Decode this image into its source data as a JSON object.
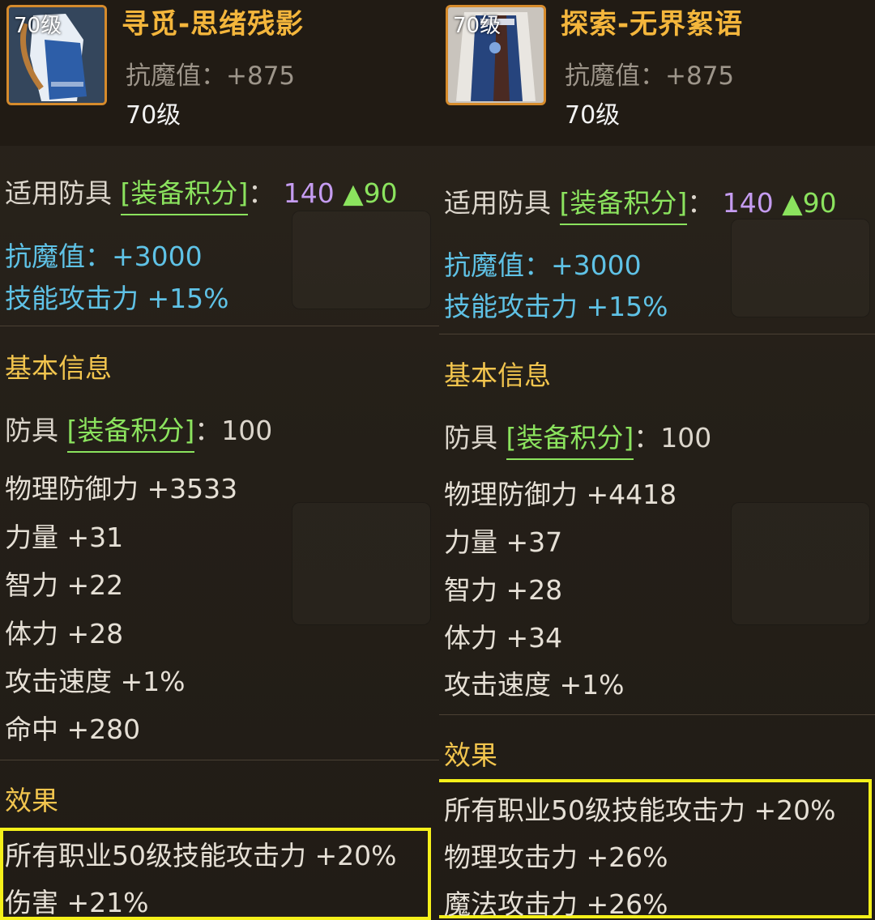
{
  "items": [
    {
      "thumb_level": "70级",
      "name": "寻觅-思绪残影",
      "magic_resist_label": "抗魔值：",
      "magic_resist_value": "+875",
      "level": "70级",
      "applicable_prefix": "适用防具",
      "applicable_tag": "[装备积分]",
      "applicable_colon": "：",
      "applicable_score": "140",
      "applicable_up": "▲90",
      "bonus_mres": "抗魔值：+3000",
      "bonus_skill": "技能攻击力 +15%",
      "basic_title": "基本信息",
      "armor_prefix": "防具",
      "armor_tag": "[装备积分]",
      "armor_value": "：100",
      "stats": [
        "物理防御力 +3533",
        "力量 +31",
        "智力 +22",
        "体力 +28",
        "攻击速度 +1%",
        "命中 +280"
      ],
      "effects_title": "效果",
      "effects": [
        "所有职业50级技能攻击力 +20%",
        "伤害 +21%"
      ]
    },
    {
      "thumb_level": "70级",
      "name": "探索-无界絮语",
      "magic_resist_label": "抗魔值：",
      "magic_resist_value": "+875",
      "level": "70级",
      "applicable_prefix": "适用防具",
      "applicable_tag": "[装备积分]",
      "applicable_colon": "：",
      "applicable_score": "140",
      "applicable_up": "▲90",
      "bonus_mres": "抗魔值：+3000",
      "bonus_skill": "技能攻击力 +15%",
      "basic_title": "基本信息",
      "armor_prefix": "防具",
      "armor_tag": "[装备积分]",
      "armor_value": "：100",
      "stats": [
        "物理防御力 +4418",
        "力量 +37",
        "智力 +28",
        "体力 +34",
        "攻击速度 +1%"
      ],
      "effects_title": "效果",
      "effects": [
        "所有职业50级技能攻击力 +20%",
        "物理攻击力 +26%",
        "魔法攻击力 +26%"
      ]
    }
  ]
}
